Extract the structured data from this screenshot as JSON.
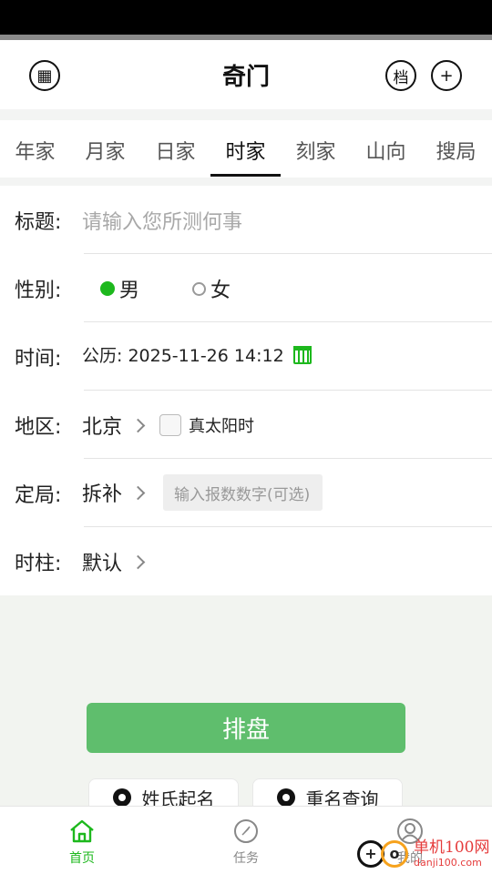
{
  "header": {
    "title": "奇门",
    "archive_label": "档",
    "plus_label": "+"
  },
  "tabs": [
    {
      "label": "年家"
    },
    {
      "label": "月家"
    },
    {
      "label": "日家"
    },
    {
      "label": "时家"
    },
    {
      "label": "刻家"
    },
    {
      "label": "山向"
    },
    {
      "label": "搜局"
    }
  ],
  "form": {
    "title": {
      "label": "标题:",
      "placeholder": "请输入您所测何事"
    },
    "gender": {
      "label": "性别:",
      "male": "男",
      "female": "女",
      "selected": "男"
    },
    "time": {
      "label": "时间:",
      "value": "公历: 2025-11-26 14:12"
    },
    "region": {
      "label": "地区:",
      "value": "北京",
      "true_solar": "真太阳时"
    },
    "ding_ju": {
      "label": "定局:",
      "value": "拆补",
      "number_placeholder": "输入报数数字(可选)"
    },
    "shi_zhu": {
      "label": "时柱:",
      "value": "默认"
    }
  },
  "actions": {
    "pai_pan": "排盘",
    "surname_naming": "姓氏起名",
    "name_check": "重名查询"
  },
  "nav": [
    {
      "label": "首页"
    },
    {
      "label": "任务"
    },
    {
      "label": "我的"
    }
  ],
  "watermark": {
    "line1": "单机100网",
    "line2": "danji100.com"
  },
  "colors": {
    "accent": "#1db81d",
    "button": "#5fbe6d"
  }
}
